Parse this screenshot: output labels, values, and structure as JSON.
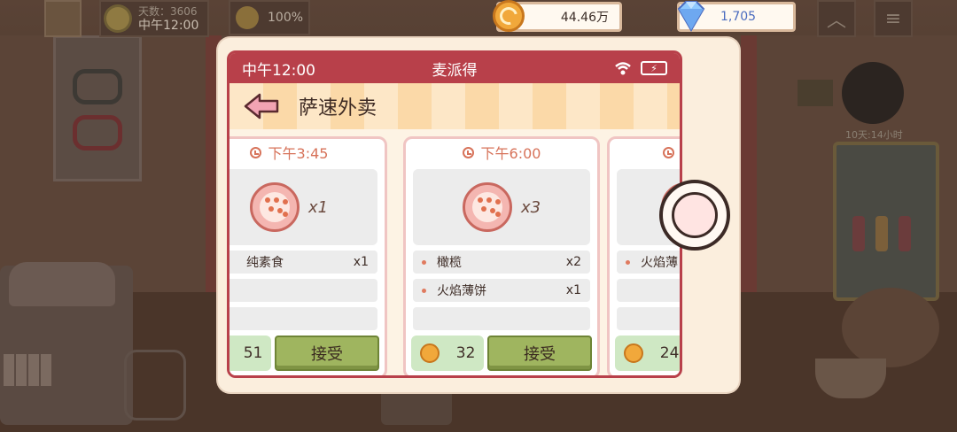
{
  "hud": {
    "day_label": "天数：3606",
    "time_of_day": "中午12:00",
    "mood_percent": "100%",
    "coins": "44.46万",
    "gems": "1,705",
    "up_icon": "chevron-up-icon",
    "menu_icon": "hamburger-menu-icon",
    "event_timer": "10天:14小时"
  },
  "phone": {
    "status_time": "中午12:00",
    "app_name": "麦派得",
    "page_title": "萨速外卖",
    "accent_color": "#b8404a"
  },
  "orders": [
    {
      "time": "下午3:45",
      "pizza_qty": "x1",
      "items": [
        {
          "name": "纯素食",
          "qty": "x1"
        }
      ],
      "price": "51",
      "accept_label": "接受"
    },
    {
      "time": "下午6:00",
      "pizza_qty": "x3",
      "items": [
        {
          "name": "橄榄",
          "qty": "x2"
        },
        {
          "name": "火焰薄饼",
          "qty": "x1"
        }
      ],
      "price": "32",
      "accept_label": "接受"
    },
    {
      "time": "",
      "pizza_qty": "",
      "items": [
        {
          "name": "火焰薄",
          "qty": ""
        }
      ],
      "price": "24",
      "accept_label": ""
    }
  ]
}
